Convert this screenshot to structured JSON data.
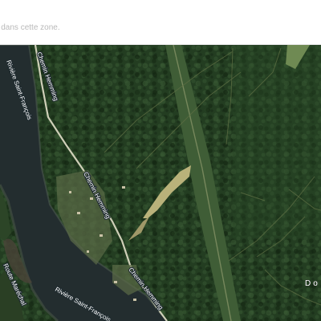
{
  "topbar": {
    "notice_text": "taires dans cette zone."
  },
  "map": {
    "view": "satellite",
    "labels": {
      "road_upper": "Chemin Hemming",
      "road_middle": "Chemin Hemming",
      "road_lower": "Chemin Hemming",
      "river_upper": "Rivière Saint-François",
      "river_lower": "Rivière Saint-François",
      "left_edge": "Route Maréchal",
      "place_right": "Do"
    },
    "colors": {
      "forest": "#223c20",
      "river": "#232d2f",
      "sandbar": "#5a4a3a",
      "clearing": "#b9b27a",
      "road": "#cfcfb8"
    }
  }
}
